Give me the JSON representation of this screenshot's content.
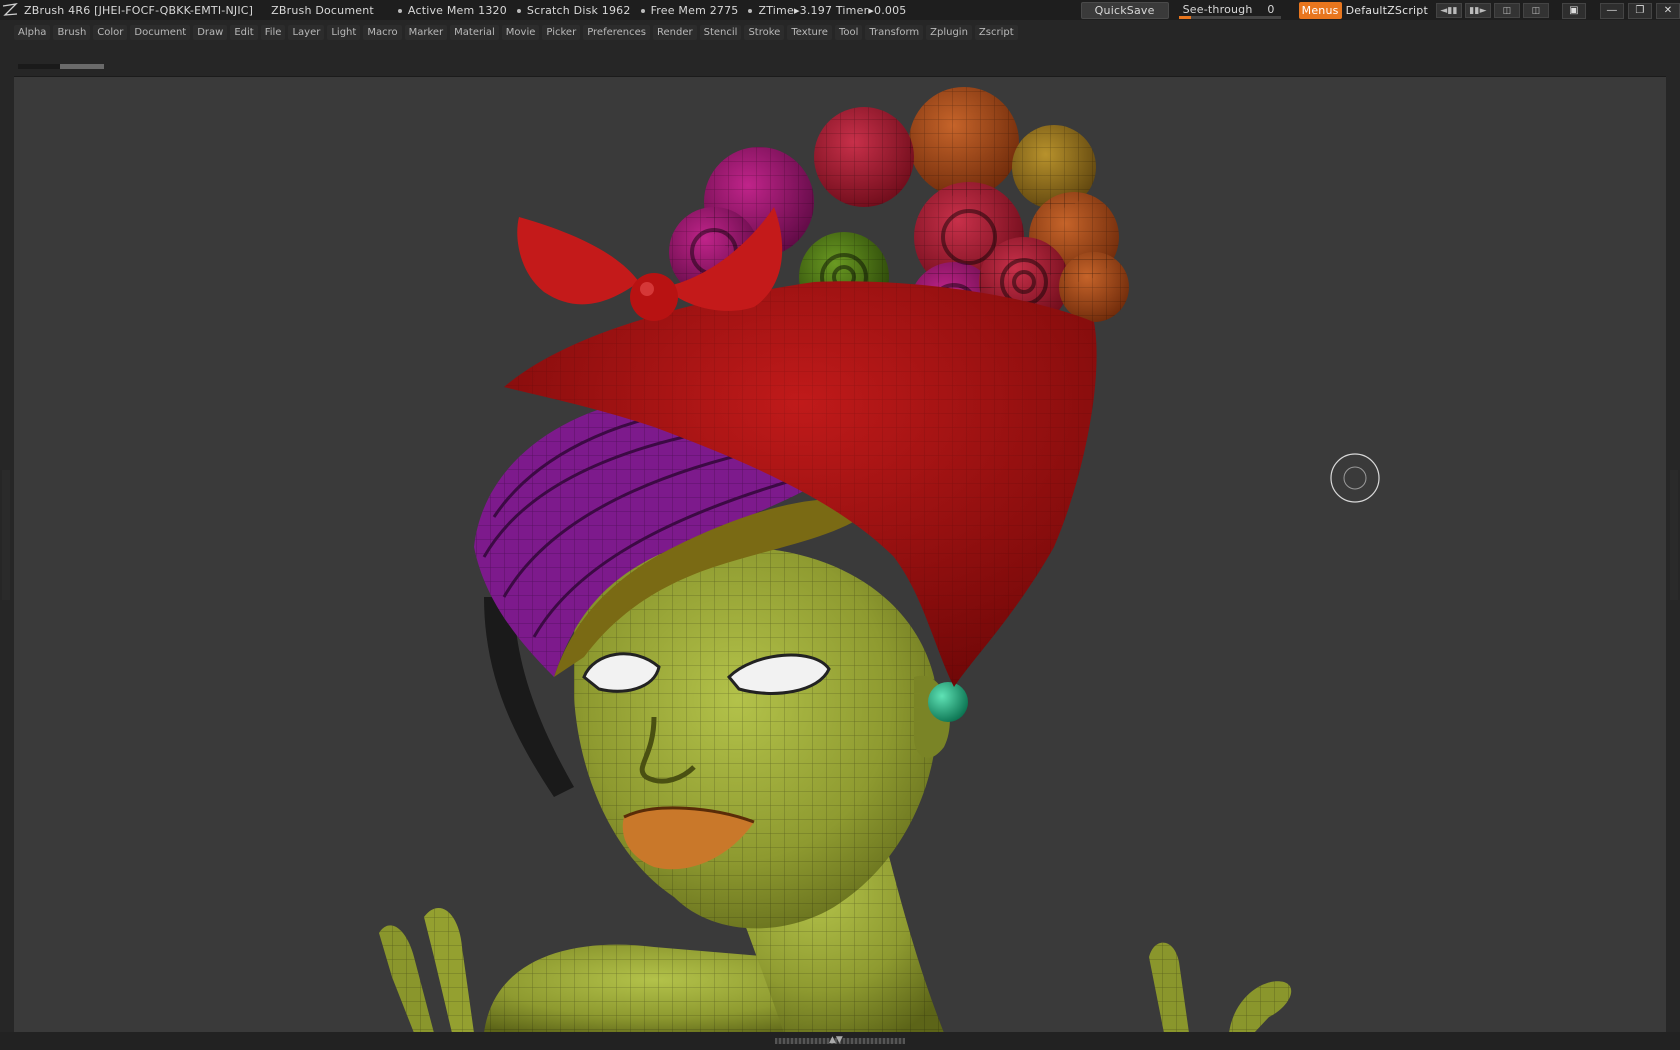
{
  "titlebar": {
    "app_title": "ZBrush 4R6 [JHEI-FOCF-QBKK-EMTI-NJIC]",
    "document_title": "ZBrush Document",
    "stats": [
      "Active Mem 1320",
      "Scratch Disk 1962",
      "Free Mem 2775",
      "ZTime▸3.197 Timer▸0.005"
    ]
  },
  "controls": {
    "quicksave_label": "QuickSave",
    "seethrough_label": "See-through",
    "seethrough_value": "0",
    "seethrough_fraction": 0,
    "menus_label": "Menus",
    "script_label": "DefaultZScript"
  },
  "menubar": {
    "items": [
      "Alpha",
      "Brush",
      "Color",
      "Document",
      "Draw",
      "Edit",
      "File",
      "Layer",
      "Light",
      "Macro",
      "Marker",
      "Material",
      "Movie",
      "Picker",
      "Preferences",
      "Render",
      "Stencil",
      "Stroke",
      "Texture",
      "Tool",
      "Transform",
      "Zplugin",
      "Zscript"
    ]
  },
  "colors": {
    "accent": "#e8761e",
    "canvas_bg": "#3a3a3a",
    "skin": "#8f9a32",
    "scarf": "#b01818",
    "hair_purple": "#8a1a9a",
    "earring": "#1fa37a"
  },
  "icons": {
    "logo": "zbrush-logo-icon",
    "cursor": "brush-cursor-icon",
    "minimize": "minimize-icon",
    "restore": "restore-icon",
    "close": "close-icon"
  }
}
